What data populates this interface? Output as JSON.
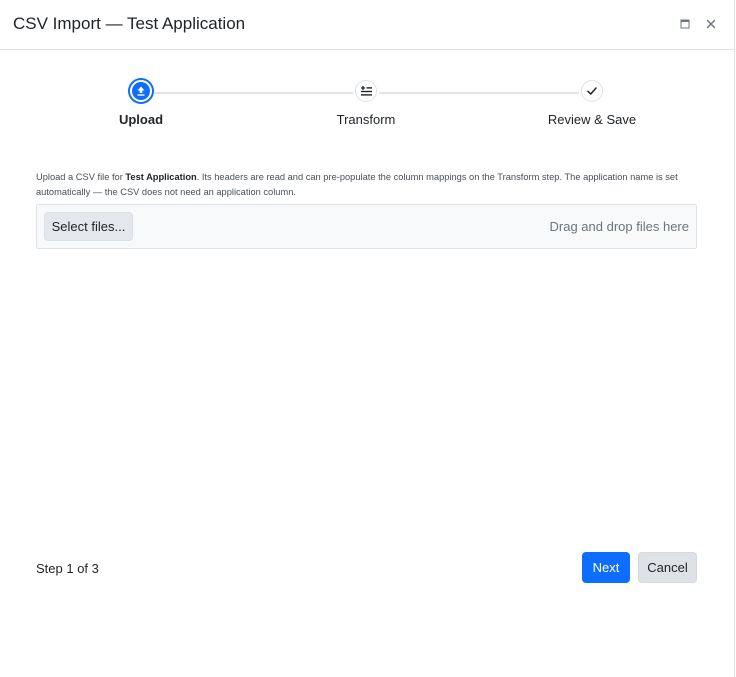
{
  "window": {
    "title": "CSV Import — Test Application",
    "maximize_icon": "maximize-icon",
    "close_icon": "close-icon"
  },
  "stepper": {
    "active_color": "#0d6efd",
    "steps": [
      {
        "label": "Upload",
        "icon": "upload-icon",
        "state": "active"
      },
      {
        "label": "Transform",
        "icon": "transform-list-icon",
        "state": "pending"
      },
      {
        "label": "Review & Save",
        "icon": "checkmark-icon",
        "state": "pending"
      }
    ]
  },
  "upload": {
    "description_prefix": "Upload a CSV file for ",
    "application_name": "Test Application",
    "description_suffix": ". Its headers are read and can pre-populate the column mappings on the Transform step. The application name is set automatically — the CSV does not need an application column.",
    "select_button": "Select files...",
    "drop_hint": "Drag and drop files here"
  },
  "footer": {
    "step_count": "Step 1 of 3",
    "next_button": "Next",
    "cancel_button": "Cancel"
  }
}
